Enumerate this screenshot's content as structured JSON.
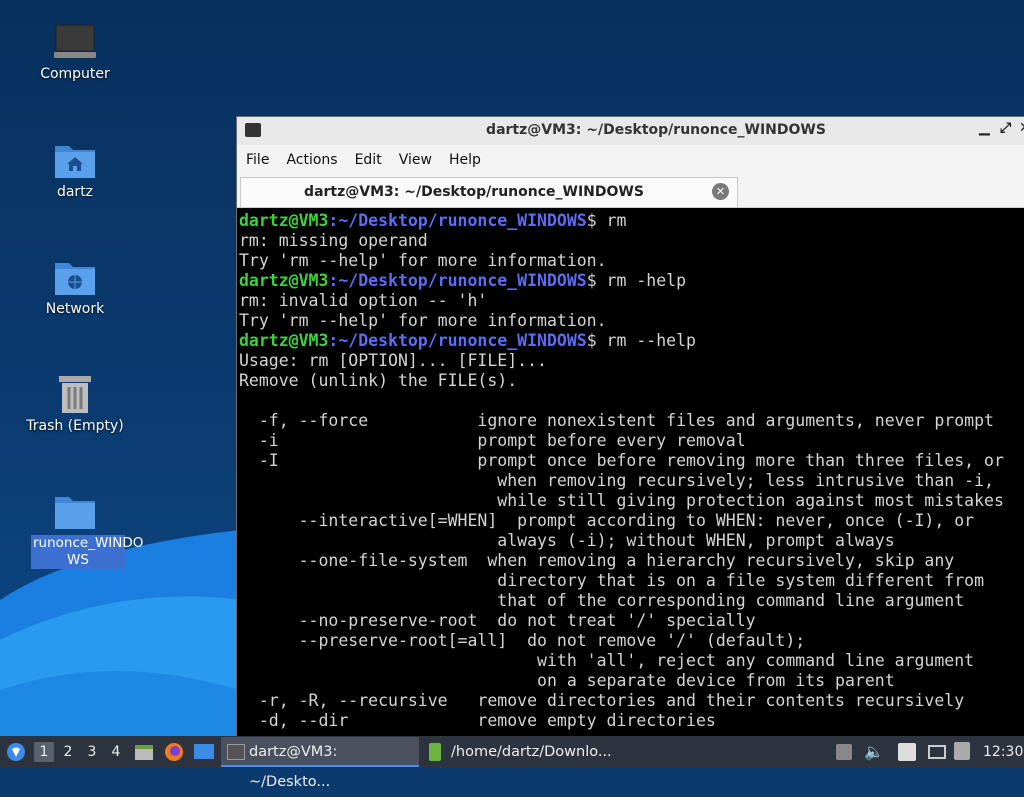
{
  "desktop": {
    "icons": [
      {
        "label": "Computer"
      },
      {
        "label": "dartz"
      },
      {
        "label": "Network"
      },
      {
        "label": "Trash (Empty)"
      },
      {
        "label_line1": "runonce_WINDO",
        "label_line2": "WS"
      }
    ]
  },
  "terminal": {
    "title": "dartz@VM3: ~/Desktop/runonce_WINDOWS",
    "menu": [
      "File",
      "Actions",
      "Edit",
      "View",
      "Help"
    ],
    "tab_label": "dartz@VM3: ~/Desktop/runonce_WINDOWS",
    "prompt_user": "dartz@VM3",
    "prompt_path": ":~/Desktop/runonce_WINDOWS",
    "lines": [
      {
        "type": "prompt",
        "cmd": "$ rm"
      },
      {
        "type": "out",
        "text": "rm: missing operand"
      },
      {
        "type": "out",
        "text": "Try 'rm --help' for more information."
      },
      {
        "type": "prompt",
        "cmd": "$ rm -help"
      },
      {
        "type": "out",
        "text": "rm: invalid option -- 'h'"
      },
      {
        "type": "out",
        "text": "Try 'rm --help' for more information."
      },
      {
        "type": "prompt",
        "cmd": "$ rm --help"
      },
      {
        "type": "out",
        "text": "Usage: rm [OPTION]... [FILE]..."
      },
      {
        "type": "out",
        "text": "Remove (unlink) the FILE(s)."
      },
      {
        "type": "out",
        "text": ""
      },
      {
        "type": "out",
        "text": "  -f, --force           ignore nonexistent files and arguments, never prompt"
      },
      {
        "type": "out",
        "text": "  -i                    prompt before every removal"
      },
      {
        "type": "out",
        "text": "  -I                    prompt once before removing more than three files, or"
      },
      {
        "type": "out",
        "text": "                          when removing recursively; less intrusive than -i,"
      },
      {
        "type": "out",
        "text": "                          while still giving protection against most mistakes"
      },
      {
        "type": "out",
        "text": "      --interactive[=WHEN]  prompt according to WHEN: never, once (-I), or"
      },
      {
        "type": "out",
        "text": "                          always (-i); without WHEN, prompt always"
      },
      {
        "type": "out",
        "text": "      --one-file-system  when removing a hierarchy recursively, skip any"
      },
      {
        "type": "out",
        "text": "                          directory that is on a file system different from"
      },
      {
        "type": "out",
        "text": "                          that of the corresponding command line argument"
      },
      {
        "type": "out",
        "text": "      --no-preserve-root  do not treat '/' specially"
      },
      {
        "type": "out",
        "text": "      --preserve-root[=all]  do not remove '/' (default);"
      },
      {
        "type": "out",
        "text": "                              with 'all', reject any command line argument"
      },
      {
        "type": "out",
        "text": "                              on a separate device from its parent"
      },
      {
        "type": "out",
        "text": "  -r, -R, --recursive   remove directories and their contents recursively"
      },
      {
        "type": "out",
        "text": "  -d, --dir             remove empty directories"
      }
    ]
  },
  "taskbar": {
    "workspaces": [
      "1",
      "2",
      "3",
      "4"
    ],
    "tasks": [
      {
        "label": "dartz@VM3: ~/Deskto...",
        "icon": "terminal-icon"
      },
      {
        "label": "/home/dartz/Downlo...",
        "icon": "archive-icon"
      }
    ],
    "clock": "12:30"
  }
}
